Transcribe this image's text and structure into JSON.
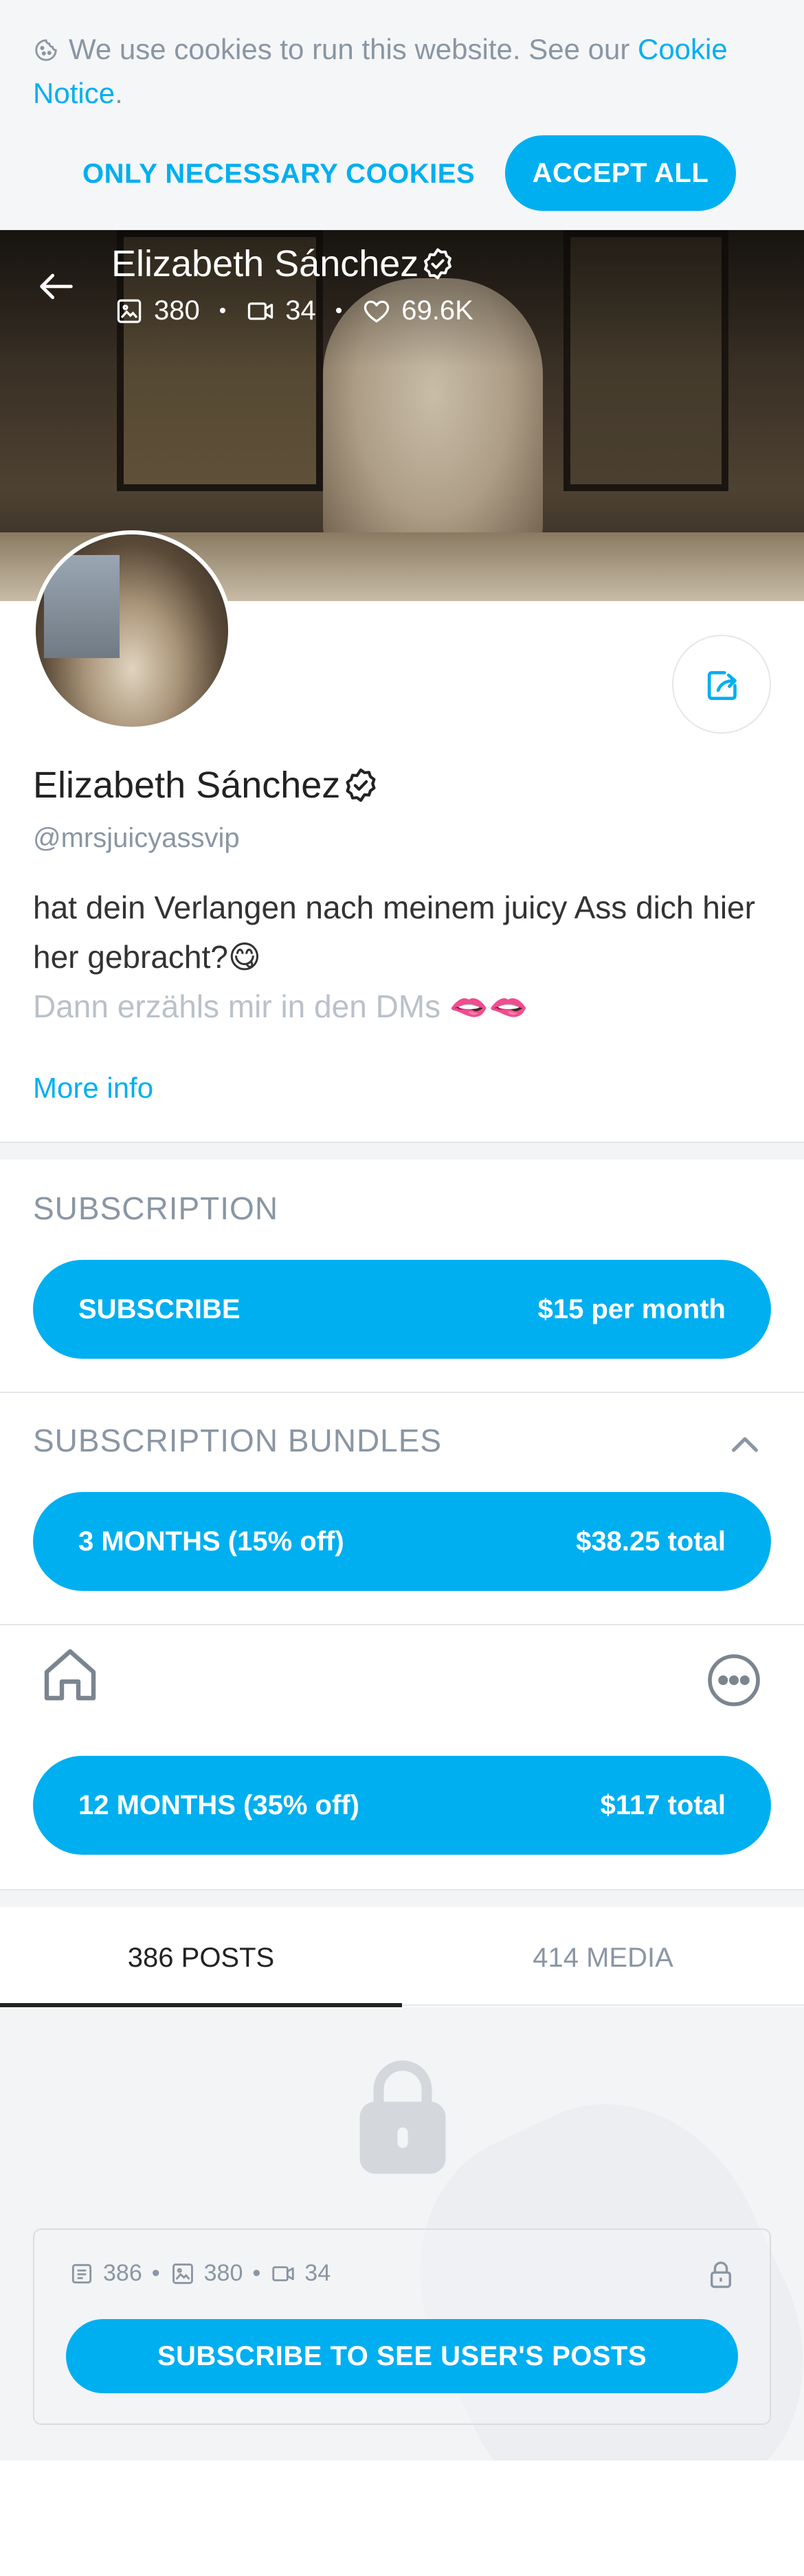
{
  "cookie_banner": {
    "text": "We use cookies to run this website. See our ",
    "link_text": "Cookie Notice",
    "link_suffix": ".",
    "necessary_label": "ONLY NECESSARY COOKIES",
    "accept_label": "ACCEPT ALL"
  },
  "cover": {
    "name": "Elizabeth Sánchez",
    "stats": {
      "images": "380",
      "videos": "34",
      "likes": "69.6K"
    }
  },
  "profile": {
    "name": "Elizabeth Sánchez",
    "handle": "@mrsjuicyassvip",
    "bio_line1": "hat dein Verlangen nach meinem juicy Ass dich hier her gebracht?😋",
    "bio_line2": "Dann erzähls mir in den DMs 🫦🫦",
    "more_info": "More info"
  },
  "subscription": {
    "title": "SUBSCRIPTION",
    "subscribe_label": "SUBSCRIBE",
    "subscribe_price": "$15 per month"
  },
  "bundles": {
    "title": "SUBSCRIPTION BUNDLES",
    "items": [
      {
        "label": "3 MONTHS (15% off)",
        "price": "$38.25 total"
      },
      {
        "label": "12 MONTHS (35% off)",
        "price": "$117 total"
      }
    ]
  },
  "tabs": [
    {
      "label": "386 POSTS"
    },
    {
      "label": "414 MEDIA"
    }
  ],
  "locked": {
    "posts": "386",
    "images": "380",
    "videos": "34",
    "button_label": "SUBSCRIBE TO SEE USER'S POSTS"
  },
  "colors": {
    "accent": "#00aff0",
    "muted": "#8a96a3",
    "background_gray": "#f3f4f6"
  },
  "icons": [
    "cookie-icon",
    "back-arrow-icon",
    "verified-icon",
    "image-icon",
    "video-icon",
    "heart-icon",
    "share-icon",
    "chevron-up-icon",
    "home-icon",
    "more-icon",
    "lock-icon",
    "post-icon"
  ]
}
